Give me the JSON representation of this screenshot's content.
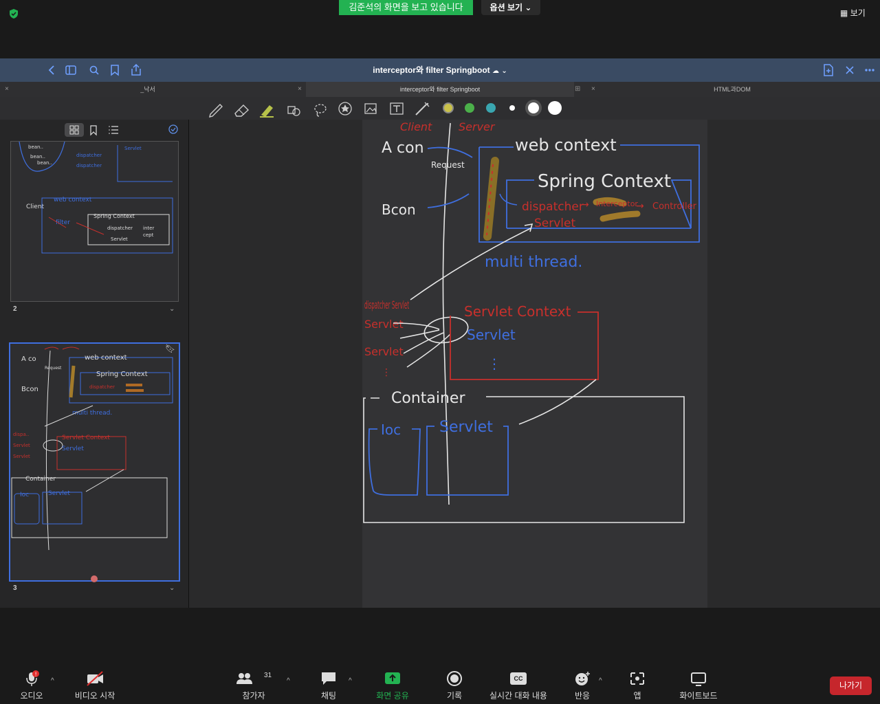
{
  "zoom": {
    "share_banner": "김준석의 화면을 보고 있습니다",
    "view_options": "옵션 보기",
    "view_button": "보기",
    "bottom": {
      "audio": "오디오",
      "video": "비디오 시작",
      "participants": "참가자",
      "participants_count": "31",
      "chat": "채팅",
      "share": "화면 공유",
      "record": "기록",
      "captions": "실시간 대화 내용",
      "captions_icon": "CC",
      "reactions": "반응",
      "apps": "앱",
      "whiteboard": "화이트보드",
      "leave": "나가기"
    }
  },
  "goodnotes": {
    "title": "interceptor와 filter Springboot",
    "tabs": [
      {
        "label": "_낙서"
      },
      {
        "label": "interceptor와 filter Springboot"
      },
      {
        "label": "HTML과DOM"
      }
    ],
    "thumbnails": [
      {
        "page": "2"
      },
      {
        "page": "3"
      }
    ],
    "colors": [
      "#c9c14a",
      "#4bb04a",
      "#3aa6b0",
      "#ffffff",
      "#ffffff",
      "#ffffff"
    ]
  },
  "note": {
    "client": "Client",
    "server": "Server",
    "a_con": "A con",
    "b_con": "Bcon",
    "request": "Request",
    "web_context": "web context",
    "spring_context": "Spring Context",
    "dispatcher": "dispatcher",
    "servlet_red": "Servlet",
    "filter": "Interceptor",
    "controller": "Controller",
    "multi_thread": "multi thread.",
    "dispatcher_servlet": "dispatcher Servlet",
    "servlet_context": "Servlet Context",
    "servlet_blue": "Servlet",
    "container": "Container",
    "ioc": "Ioc",
    "servlet_box": "Servlet"
  }
}
